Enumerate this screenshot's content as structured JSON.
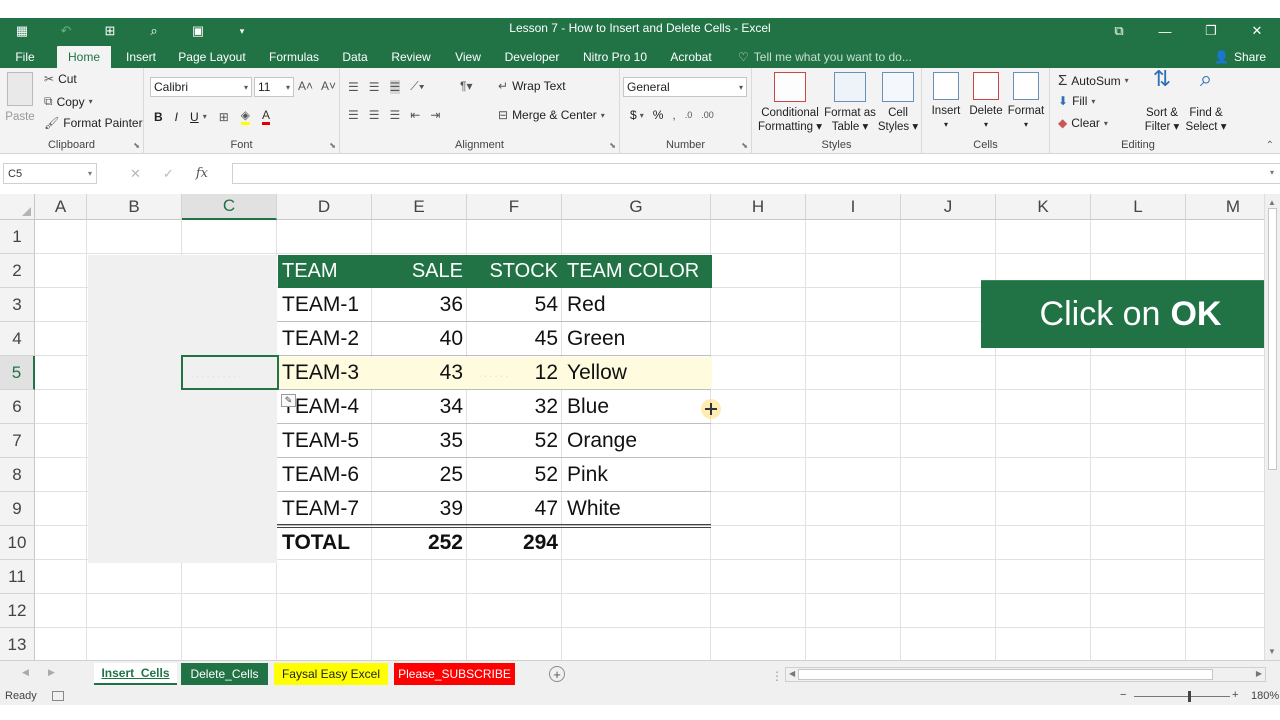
{
  "window": {
    "title": "Lesson 7 - How to Insert and Delete Cells - Excel",
    "qat_icons": [
      "autosave-icon",
      "undo-icon",
      "redo-icon",
      "save-icon",
      "print-preview-icon",
      "customize-qat-icon"
    ],
    "controls": [
      "ribbon-display-icon",
      "minimize-icon",
      "restore-icon",
      "close-icon"
    ]
  },
  "tabs": [
    "File",
    "Home",
    "Insert",
    "Page Layout",
    "Formulas",
    "Data",
    "Review",
    "View",
    "Developer",
    "Nitro Pro 10",
    "Acrobat"
  ],
  "active_tab": "Home",
  "tell_me": "Tell me what you want to do...",
  "share": "Share",
  "ribbon": {
    "clipboard": {
      "label": "Clipboard",
      "paste": "Paste",
      "cut": "Cut",
      "copy": "Copy",
      "format_painter": "Format Painter"
    },
    "font": {
      "label": "Font",
      "name": "Calibri",
      "size": "11",
      "bold": "B",
      "italic": "I",
      "underline": "U"
    },
    "alignment": {
      "label": "Alignment",
      "wrap_text": "Wrap Text",
      "merge_center": "Merge & Center"
    },
    "number": {
      "label": "Number",
      "format": "General",
      "currency": "$",
      "percent": "%"
    },
    "styles": {
      "label": "Styles",
      "conditional_1": "Conditional",
      "conditional_2": "Formatting",
      "format_table_1": "Format as",
      "format_table_2": "Table",
      "cell_styles_1": "Cell",
      "cell_styles_2": "Styles"
    },
    "cells": {
      "label": "Cells",
      "insert": "Insert",
      "delete": "Delete",
      "format": "Format"
    },
    "editing": {
      "label": "Editing",
      "autosum": "AutoSum",
      "fill": "Fill",
      "clear": "Clear",
      "sort_1": "Sort &",
      "sort_2": "Filter",
      "find_1": "Find &",
      "find_2": "Select"
    }
  },
  "formula_bar": {
    "name_box": "C5",
    "fx": "fx",
    "value": ""
  },
  "columns": [
    "A",
    "B",
    "C",
    "D",
    "E",
    "F",
    "G",
    "H",
    "I",
    "J",
    "K",
    "L",
    "M"
  ],
  "selected_column": "C",
  "rows": [
    "1",
    "2",
    "3",
    "4",
    "5",
    "6",
    "7",
    "8",
    "9",
    "10",
    "11",
    "12",
    "13"
  ],
  "selected_row": "5",
  "table": {
    "headers": [
      "TEAM",
      "SALE",
      "STOCK",
      "TEAM COLOR"
    ],
    "rows": [
      [
        "TEAM-1",
        "36",
        "54",
        "Red"
      ],
      [
        "TEAM-2",
        "40",
        "45",
        "Green"
      ],
      [
        "TEAM-3",
        "43",
        "12",
        "Yellow"
      ],
      [
        "TEAM-4",
        "34",
        "32",
        "Blue"
      ],
      [
        "TEAM-5",
        "35",
        "52",
        "Orange"
      ],
      [
        "TEAM-6",
        "25",
        "52",
        "Pink"
      ],
      [
        "TEAM-7",
        "39",
        "47",
        "White"
      ]
    ],
    "total": [
      "TOTAL",
      "252",
      "294",
      ""
    ],
    "highlighted_row": "TEAM-3"
  },
  "overlay": {
    "text": "Click on",
    "bold": "OK"
  },
  "sheets": [
    {
      "name": "Insert_Cells",
      "active": true,
      "color": "#217346"
    },
    {
      "name": "Delete_Cells",
      "active": false,
      "color": "#217346"
    },
    {
      "name": "Faysal Easy Excel",
      "active": false,
      "color": "#ffff00"
    },
    {
      "name": "Please_SUBSCRIBE",
      "active": false,
      "color": "#ff0000"
    }
  ],
  "status": {
    "ready": "Ready",
    "zoom": "180%"
  },
  "colors": {
    "accent": "#217346",
    "highlight": "#fffbdf"
  }
}
